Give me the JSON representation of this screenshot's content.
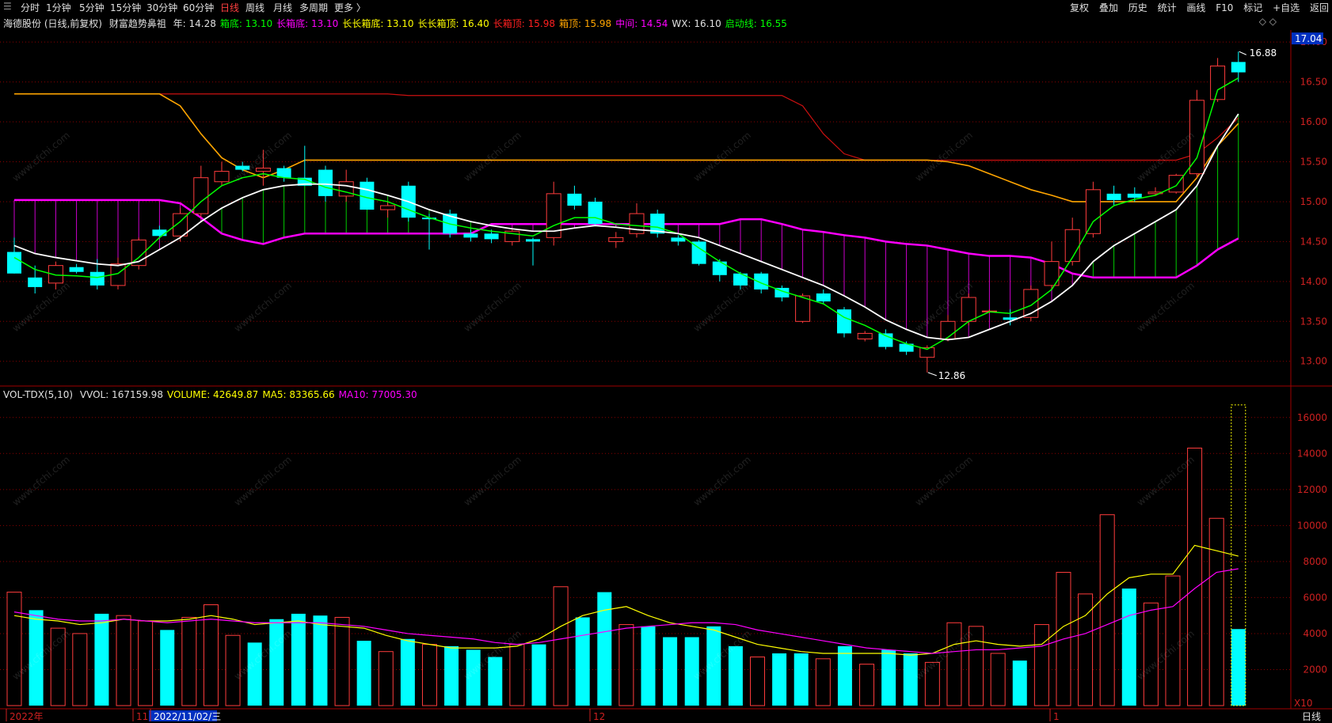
{
  "toolbar": {
    "left": [
      "分时",
      "1分钟",
      "5分钟",
      "15分钟",
      "30分钟",
      "60分钟",
      "日线",
      "周线",
      "月线",
      "多周期",
      "更多 〉"
    ],
    "active": "日线",
    "right": [
      "复权",
      "叠加",
      "历史",
      "统计",
      "画线",
      "F10",
      "+自选",
      "返回"
    ],
    "marker": "标记"
  },
  "price_header": {
    "stock": "海德股份 (日线,前复权)",
    "indicator": "财富趋势鼻祖",
    "items": [
      {
        "label": "年: 14.28",
        "color": "#e0e0e0"
      },
      {
        "label": "箱底: 13.10",
        "color": "#00ff00"
      },
      {
        "label": "长箱底: 13.10",
        "color": "#ff00ff"
      },
      {
        "label": "长长箱底: 13.10",
        "color": "#ffff00"
      },
      {
        "label": "长长箱顶: 16.40",
        "color": "#ffff00"
      },
      {
        "label": "长箱顶: 15.98",
        "color": "#ff2020"
      },
      {
        "label": "箱顶: 15.98",
        "color": "#ffa500"
      },
      {
        "label": "中间: 14.54",
        "color": "#ff00ff"
      },
      {
        "label": "WX: 16.10",
        "color": "#e0e0e0"
      },
      {
        "label": "启动线: 16.55",
        "color": "#00ff00"
      }
    ]
  },
  "volume_header": {
    "name": "VOL-TDX(5,10)",
    "items": [
      {
        "label": "VVOL: 167159.98",
        "color": "#e0e0e0"
      },
      {
        "label": "VOLUME: 42649.87",
        "color": "#ffff00"
      },
      {
        "label": "MA5: 83365.66",
        "color": "#ffff00"
      },
      {
        "label": "MA10: 77005.30",
        "color": "#ff00ff"
      }
    ]
  },
  "price_axis": {
    "ticks": [
      "17.00",
      "16.50",
      "16.00",
      "15.50",
      "15.00",
      "14.50",
      "14.00",
      "13.50",
      "13.00"
    ],
    "current": "17.04"
  },
  "volume_axis": {
    "ticks": [
      "16000",
      "14000",
      "12000",
      "10000",
      "8000",
      "6000",
      "4000",
      "2000"
    ],
    "unit": "X10"
  },
  "annotations": {
    "high": "16.88",
    "low": "12.86"
  },
  "date_axis": {
    "labels": [
      "2022年",
      "11",
      "2022/11/02/三",
      "12",
      "1"
    ],
    "period": "日线"
  },
  "watermark": "www.cfchi.com",
  "colors": {
    "up": "#ff3c3c",
    "down": "#00ffff",
    "ma_white": "#ffffff",
    "ma_green": "#00ff00",
    "orange": "#ffa500",
    "magenta": "#ff00ff",
    "red": "#cc1010",
    "grid": "#8b0000"
  },
  "chart_data": [
    {
      "type": "candlestick",
      "candles": [
        {
          "o": 14.37,
          "h": 14.55,
          "l": 14.1,
          "c": 14.1
        },
        {
          "o": 14.05,
          "h": 14.2,
          "l": 13.85,
          "c": 13.93
        },
        {
          "o": 13.98,
          "h": 14.25,
          "l": 13.9,
          "c": 14.2
        },
        {
          "o": 14.18,
          "h": 14.22,
          "l": 14.1,
          "c": 14.12
        },
        {
          "o": 14.12,
          "h": 14.28,
          "l": 13.9,
          "c": 13.95
        },
        {
          "o": 13.95,
          "h": 14.3,
          "l": 13.9,
          "c": 14.22
        },
        {
          "o": 14.2,
          "h": 14.55,
          "l": 14.15,
          "c": 14.52
        },
        {
          "o": 14.65,
          "h": 14.7,
          "l": 14.55,
          "c": 14.57
        },
        {
          "o": 14.57,
          "h": 14.92,
          "l": 14.5,
          "c": 14.85
        },
        {
          "o": 14.85,
          "h": 15.45,
          "l": 14.8,
          "c": 15.3
        },
        {
          "o": 15.25,
          "h": 15.5,
          "l": 15.2,
          "c": 15.38
        },
        {
          "o": 15.45,
          "h": 15.5,
          "l": 15.38,
          "c": 15.4
        },
        {
          "o": 15.38,
          "h": 15.65,
          "l": 15.2,
          "c": 15.42
        },
        {
          "o": 15.42,
          "h": 15.45,
          "l": 15.25,
          "c": 15.3
        },
        {
          "o": 15.3,
          "h": 15.7,
          "l": 15.2,
          "c": 15.2
        },
        {
          "o": 15.4,
          "h": 15.45,
          "l": 15.0,
          "c": 15.07
        },
        {
          "o": 15.07,
          "h": 15.4,
          "l": 15.0,
          "c": 15.25
        },
        {
          "o": 15.25,
          "h": 15.3,
          "l": 14.9,
          "c": 14.9
        },
        {
          "o": 14.9,
          "h": 15.0,
          "l": 14.8,
          "c": 14.95
        },
        {
          "o": 15.2,
          "h": 15.25,
          "l": 14.75,
          "c": 14.8
        },
        {
          "o": 14.8,
          "h": 14.85,
          "l": 14.4,
          "c": 14.78
        },
        {
          "o": 14.85,
          "h": 14.9,
          "l": 14.55,
          "c": 14.6
        },
        {
          "o": 14.6,
          "h": 14.65,
          "l": 14.5,
          "c": 14.55
        },
        {
          "o": 14.6,
          "h": 14.65,
          "l": 14.48,
          "c": 14.53
        },
        {
          "o": 14.5,
          "h": 14.65,
          "l": 14.45,
          "c": 14.63
        },
        {
          "o": 14.53,
          "h": 14.55,
          "l": 14.2,
          "c": 14.5
        },
        {
          "o": 14.55,
          "h": 15.25,
          "l": 14.45,
          "c": 15.1
        },
        {
          "o": 15.1,
          "h": 15.2,
          "l": 14.9,
          "c": 14.95
        },
        {
          "o": 15.0,
          "h": 15.05,
          "l": 14.7,
          "c": 14.72
        },
        {
          "o": 14.5,
          "h": 14.62,
          "l": 14.42,
          "c": 14.55
        },
        {
          "o": 14.6,
          "h": 14.98,
          "l": 14.55,
          "c": 14.85
        },
        {
          "o": 14.85,
          "h": 14.9,
          "l": 14.55,
          "c": 14.6
        },
        {
          "o": 14.55,
          "h": 14.58,
          "l": 14.45,
          "c": 14.5
        },
        {
          "o": 14.5,
          "h": 14.52,
          "l": 14.2,
          "c": 14.22
        },
        {
          "o": 14.25,
          "h": 14.28,
          "l": 14.0,
          "c": 14.08
        },
        {
          "o": 14.1,
          "h": 14.12,
          "l": 13.9,
          "c": 13.95
        },
        {
          "o": 14.1,
          "h": 14.12,
          "l": 13.85,
          "c": 13.9
        },
        {
          "o": 13.92,
          "h": 13.95,
          "l": 13.75,
          "c": 13.8
        },
        {
          "o": 13.5,
          "h": 13.85,
          "l": 13.48,
          "c": 13.82
        },
        {
          "o": 13.85,
          "h": 13.9,
          "l": 13.72,
          "c": 13.75
        },
        {
          "o": 13.65,
          "h": 13.68,
          "l": 13.3,
          "c": 13.35
        },
        {
          "o": 13.28,
          "h": 13.38,
          "l": 13.25,
          "c": 13.35
        },
        {
          "o": 13.35,
          "h": 13.4,
          "l": 13.15,
          "c": 13.18
        },
        {
          "o": 13.22,
          "h": 13.25,
          "l": 13.08,
          "c": 13.12
        },
        {
          "o": 13.05,
          "h": 13.2,
          "l": 12.86,
          "c": 13.17
        },
        {
          "o": 13.28,
          "h": 13.58,
          "l": 13.25,
          "c": 13.5
        },
        {
          "o": 13.5,
          "h": 13.85,
          "l": 13.45,
          "c": 13.8
        },
        {
          "o": 13.62,
          "h": 13.65,
          "l": 13.6,
          "c": 13.63
        },
        {
          "o": 13.55,
          "h": 13.65,
          "l": 13.45,
          "c": 13.52
        },
        {
          "o": 13.55,
          "h": 13.95,
          "l": 13.5,
          "c": 13.9
        },
        {
          "o": 13.95,
          "h": 14.5,
          "l": 13.9,
          "c": 14.25
        },
        {
          "o": 14.25,
          "h": 14.8,
          "l": 14.2,
          "c": 14.65
        },
        {
          "o": 14.6,
          "h": 15.25,
          "l": 14.55,
          "c": 15.15
        },
        {
          "o": 15.1,
          "h": 15.2,
          "l": 14.95,
          "c": 15.02
        },
        {
          "o": 15.1,
          "h": 15.18,
          "l": 15.0,
          "c": 15.05
        },
        {
          "o": 15.1,
          "h": 15.18,
          "l": 15.08,
          "c": 15.12
        },
        {
          "o": 15.12,
          "h": 15.35,
          "l": 15.1,
          "c": 15.33
        },
        {
          "o": 15.35,
          "h": 16.4,
          "l": 15.3,
          "c": 16.27
        },
        {
          "o": 16.28,
          "h": 16.8,
          "l": 16.25,
          "c": 16.7
        },
        {
          "o": 16.75,
          "h": 16.88,
          "l": 16.5,
          "c": 16.62
        }
      ],
      "ma_white": [
        14.45,
        14.35,
        14.3,
        14.26,
        14.22,
        14.2,
        14.25,
        14.4,
        14.55,
        14.75,
        14.92,
        15.05,
        15.15,
        15.2,
        15.22,
        15.22,
        15.2,
        15.15,
        15.08,
        15.0,
        14.9,
        14.82,
        14.75,
        14.7,
        14.66,
        14.63,
        14.63,
        14.67,
        14.7,
        14.68,
        14.65,
        14.63,
        14.6,
        14.55,
        14.45,
        14.35,
        14.25,
        14.15,
        14.05,
        13.95,
        13.82,
        13.68,
        13.52,
        13.4,
        13.3,
        13.27,
        13.3,
        13.4,
        13.5,
        13.6,
        13.75,
        13.95,
        14.25,
        14.45,
        14.6,
        14.75,
        14.9,
        15.2,
        15.7,
        16.1
      ],
      "ma_green": [
        14.3,
        14.15,
        14.08,
        14.07,
        14.05,
        14.1,
        14.3,
        14.55,
        14.75,
        15.0,
        15.2,
        15.3,
        15.35,
        15.3,
        15.28,
        15.18,
        15.12,
        15.05,
        15.0,
        14.9,
        14.8,
        14.72,
        14.67,
        14.63,
        14.6,
        14.57,
        14.7,
        14.8,
        14.8,
        14.72,
        14.7,
        14.68,
        14.6,
        14.42,
        14.25,
        14.1,
        13.98,
        13.88,
        13.8,
        13.72,
        13.55,
        13.45,
        13.32,
        13.22,
        13.15,
        13.3,
        13.5,
        13.62,
        13.6,
        13.7,
        13.9,
        14.3,
        14.75,
        14.95,
        15.03,
        15.08,
        15.2,
        15.55,
        16.4,
        16.55
      ],
      "orange_line": [
        16.35,
        16.35,
        16.35,
        16.35,
        16.35,
        16.35,
        16.35,
        16.35,
        16.2,
        15.85,
        15.55,
        15.4,
        15.3,
        15.4,
        15.52,
        15.52,
        15.52,
        15.52,
        15.52,
        15.52,
        15.52,
        15.52,
        15.52,
        15.52,
        15.52,
        15.52,
        15.52,
        15.52,
        15.52,
        15.52,
        15.52,
        15.52,
        15.52,
        15.52,
        15.52,
        15.52,
        15.52,
        15.52,
        15.52,
        15.52,
        15.52,
        15.52,
        15.52,
        15.52,
        15.52,
        15.5,
        15.45,
        15.35,
        15.25,
        15.15,
        15.08,
        15.0,
        15.0,
        15.0,
        15.0,
        15.0,
        15.0,
        15.3,
        15.7,
        15.98
      ],
      "red_line": [
        16.35,
        16.35,
        16.35,
        16.35,
        16.35,
        16.35,
        16.35,
        16.35,
        16.35,
        16.35,
        16.35,
        16.35,
        16.35,
        16.35,
        16.35,
        16.35,
        16.35,
        16.35,
        16.35,
        16.33,
        16.33,
        16.33,
        16.33,
        16.33,
        16.33,
        16.33,
        16.33,
        16.33,
        16.33,
        16.33,
        16.33,
        16.33,
        16.33,
        16.33,
        16.33,
        16.33,
        16.33,
        16.33,
        16.2,
        15.85,
        15.6,
        15.52,
        15.52,
        15.52,
        15.52,
        15.52,
        15.52,
        15.52,
        15.52,
        15.52,
        15.52,
        15.52,
        15.52,
        15.52,
        15.52,
        15.52,
        15.52,
        15.6,
        15.8,
        16.05
      ],
      "magenta_line": [
        15.02,
        15.02,
        15.02,
        15.02,
        15.02,
        15.02,
        15.02,
        15.02,
        14.98,
        14.8,
        14.6,
        14.52,
        14.47,
        14.55,
        14.6,
        14.6,
        14.6,
        14.6,
        14.6,
        14.6,
        14.6,
        14.6,
        14.6,
        14.72,
        14.72,
        14.72,
        14.72,
        14.72,
        14.72,
        14.72,
        14.72,
        14.72,
        14.72,
        14.72,
        14.72,
        14.78,
        14.78,
        14.72,
        14.65,
        14.62,
        14.58,
        14.55,
        14.5,
        14.47,
        14.45,
        14.4,
        14.35,
        14.32,
        14.32,
        14.3,
        14.22,
        14.1,
        14.05,
        14.05,
        14.05,
        14.05,
        14.05,
        14.2,
        14.4,
        14.54
      ],
      "y_range": [
        12.72,
        17.15
      ]
    },
    {
      "type": "bar",
      "volumes": [
        6300,
        5300,
        4300,
        4000,
        5100,
        5000,
        4700,
        4200,
        4900,
        5600,
        3900,
        3500,
        4800,
        5100,
        5000,
        4900,
        3600,
        3000,
        3700,
        3400,
        3300,
        3100,
        2700,
        3400,
        3400,
        6600,
        4900,
        6300,
        4500,
        4400,
        3800,
        3800,
        4400,
        3300,
        2700,
        2900,
        2900,
        2600,
        3300,
        2300,
        3100,
        2900,
        2400,
        4600,
        4400,
        2900,
        2500,
        4500,
        7400,
        6200,
        10600,
        6500,
        5700,
        7200,
        14300,
        10400,
        4250
      ],
      "volume_up": [
        true,
        false,
        true,
        true,
        false,
        true,
        true,
        false,
        true,
        true,
        true,
        false,
        false,
        false,
        false,
        true,
        false,
        true,
        false,
        true,
        false,
        false,
        false,
        true,
        false,
        true,
        false,
        false,
        true,
        false,
        false,
        false,
        false,
        false,
        true,
        false,
        false,
        true,
        false,
        true,
        false,
        false,
        true,
        true,
        true,
        true,
        false,
        true,
        true,
        true,
        true,
        false,
        true,
        true,
        true,
        true,
        false
      ],
      "vol_ma5": [
        5000,
        4800,
        4700,
        4500,
        4600,
        4800,
        4700,
        4700,
        4800,
        5000,
        4800,
        4500,
        4600,
        4700,
        4500,
        4400,
        4300,
        3900,
        3600,
        3400,
        3200,
        3200,
        3200,
        3300,
        3700,
        4400,
        5000,
        5300,
        5500,
        5000,
        4600,
        4400,
        4200,
        3800,
        3400,
        3200,
        3000,
        2900,
        2900,
        2900,
        2900,
        2800,
        2900,
        3400,
        3600,
        3400,
        3300,
        3400,
        4400,
        5000,
        6200,
        7100,
        7300,
        7300,
        8900,
        8600,
        8300
      ],
      "vol_ma10": [
        5200,
        5000,
        4800,
        4700,
        4700,
        4800,
        4700,
        4600,
        4700,
        4800,
        4700,
        4600,
        4600,
        4600,
        4600,
        4500,
        4400,
        4200,
        4000,
        3900,
        3800,
        3700,
        3500,
        3400,
        3500,
        3700,
        3900,
        4100,
        4300,
        4400,
        4500,
        4600,
        4600,
        4500,
        4200,
        4000,
        3800,
        3600,
        3400,
        3200,
        3100,
        3000,
        2900,
        3000,
        3100,
        3100,
        3200,
        3300,
        3700,
        4000,
        4500,
        5000,
        5300,
        5500,
        6500,
        7400,
        7600
      ],
      "max_bar": 16700,
      "y_range": [
        0,
        17000
      ]
    }
  ]
}
